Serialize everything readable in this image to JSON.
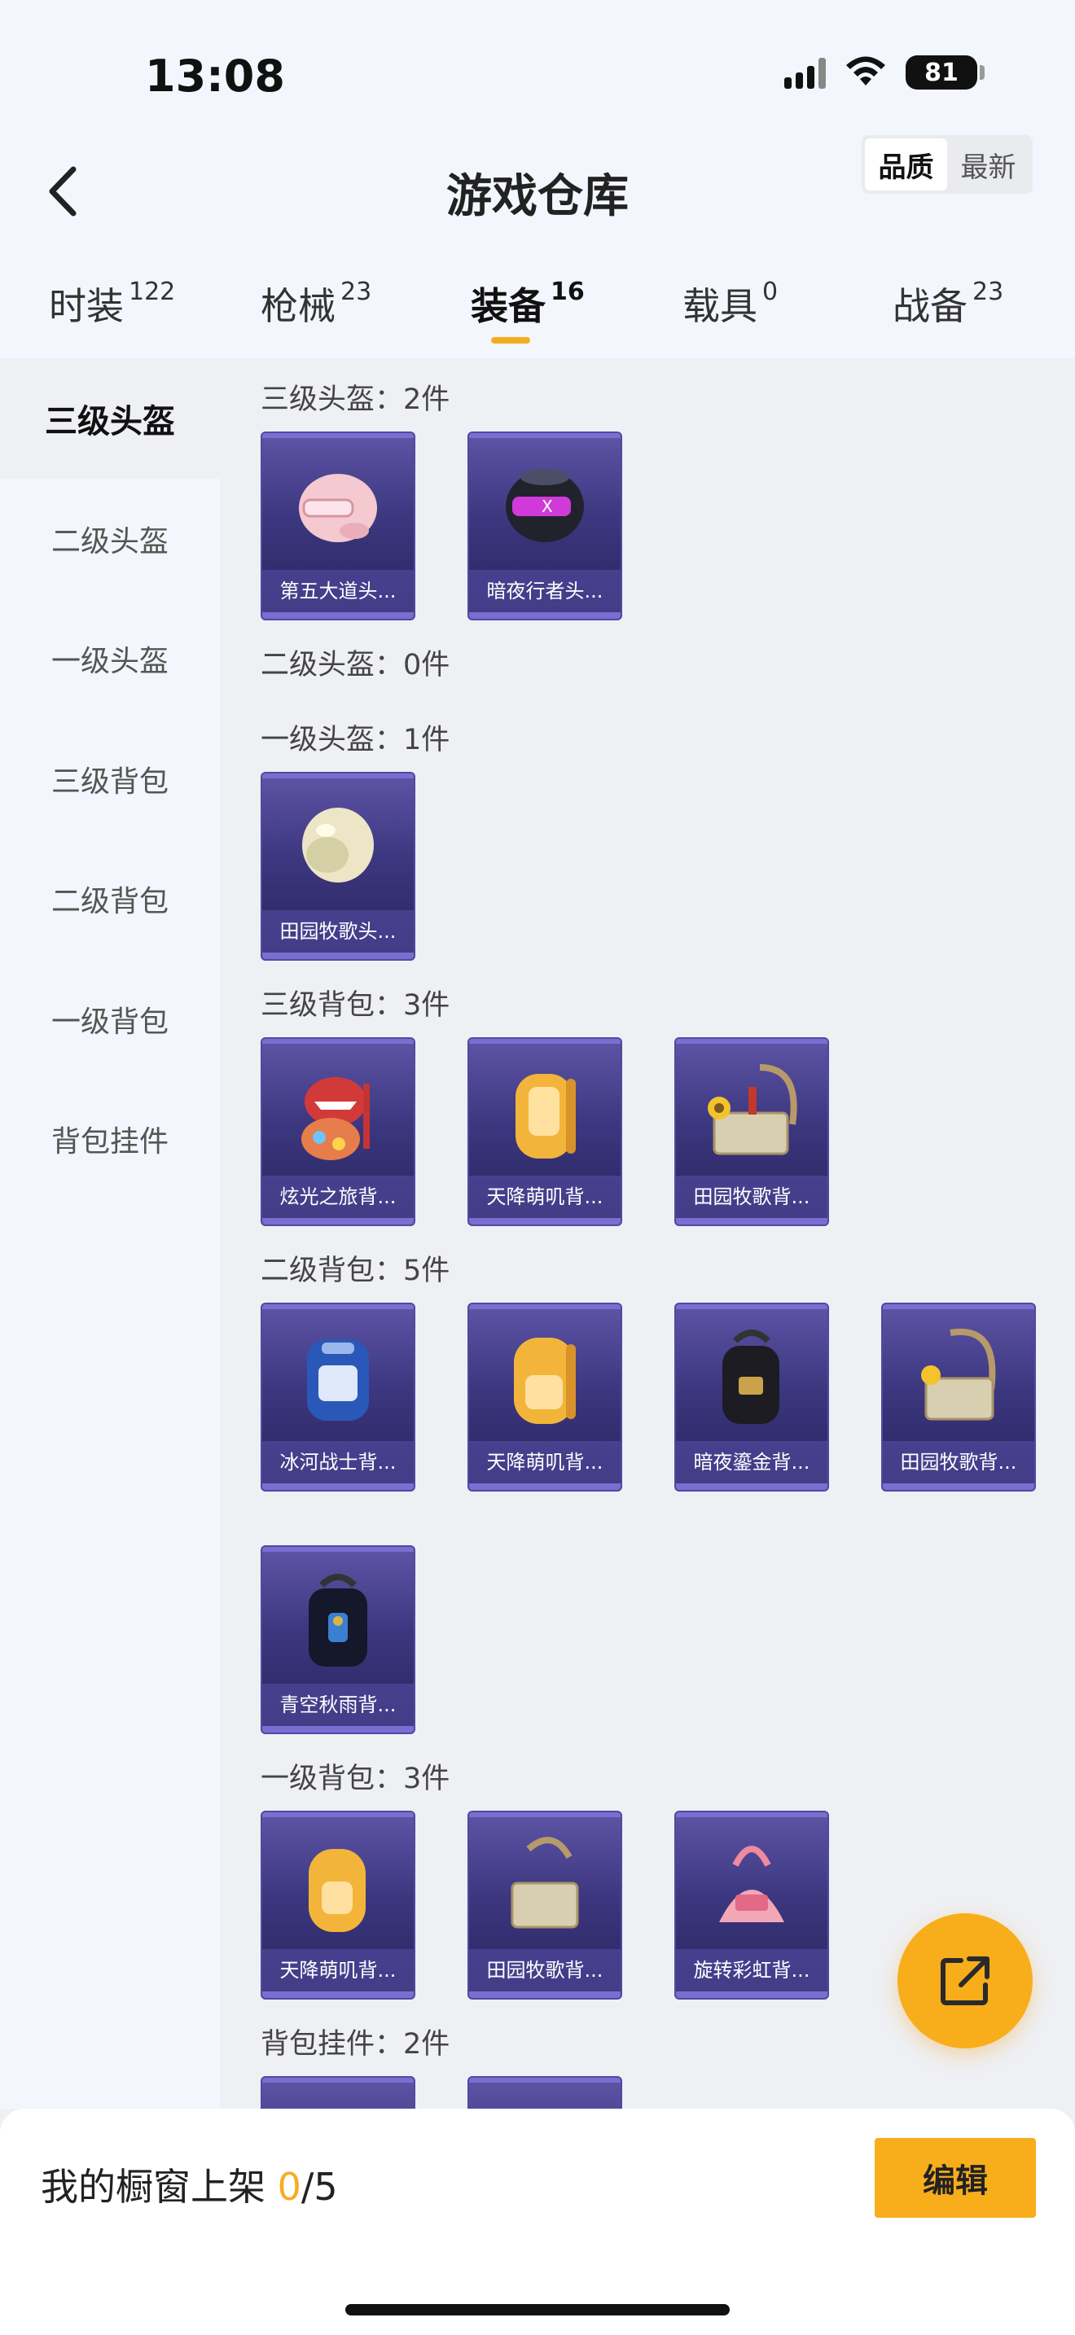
{
  "status": {
    "time": "13:08",
    "battery": "81"
  },
  "header": {
    "title": "游戏仓库",
    "sort_quality": "品质",
    "sort_newest": "最新"
  },
  "tabs": [
    {
      "label": "时装",
      "count": "122"
    },
    {
      "label": "枪械",
      "count": "23"
    },
    {
      "label": "装备",
      "count": "16"
    },
    {
      "label": "载具",
      "count": "0"
    },
    {
      "label": "战备",
      "count": "23"
    }
  ],
  "sidebar": [
    "三级头盔",
    "二级头盔",
    "一级头盔",
    "三级背包",
    "二级背包",
    "一级背包",
    "背包挂件"
  ],
  "sections": [
    {
      "title": "三级头盔：2件",
      "items": [
        "第五大道头...",
        "暗夜行者头..."
      ]
    },
    {
      "title": "二级头盔：0件",
      "items": []
    },
    {
      "title": "一级头盔：1件",
      "items": [
        "田园牧歌头..."
      ]
    },
    {
      "title": "三级背包：3件",
      "items": [
        "炫光之旅背...",
        "天降萌叽背...",
        "田园牧歌背..."
      ]
    },
    {
      "title": "二级背包：5件",
      "items": [
        "冰河战士背...",
        "天降萌叽背...",
        "暗夜鎏金背...",
        "田园牧歌背...",
        "青空秋雨背..."
      ]
    },
    {
      "title": "一级背包：3件",
      "items": [
        "天降萌叽背...",
        "田园牧歌背...",
        "旋转彩虹背..."
      ]
    },
    {
      "title": "背包挂件：2件",
      "items": [
        "",
        ""
      ]
    }
  ],
  "footer": {
    "label": "我的橱窗上架",
    "current": "0",
    "total": "/5",
    "edit": "编辑"
  }
}
